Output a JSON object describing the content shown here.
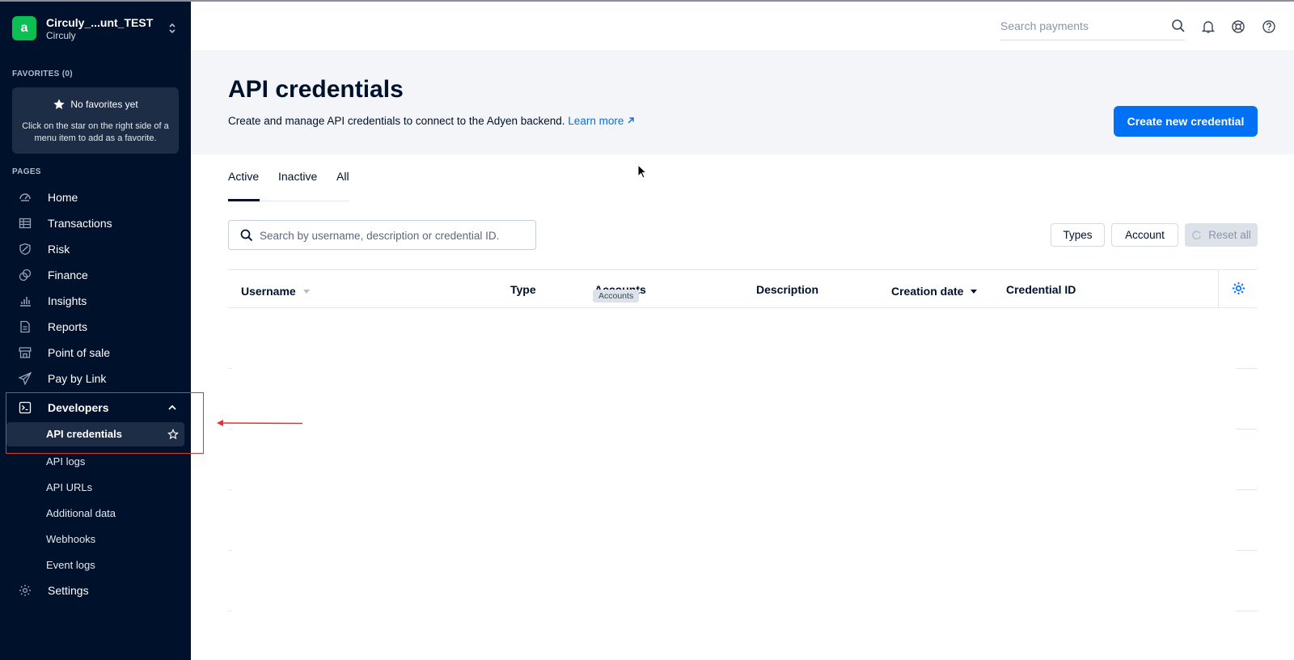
{
  "account": {
    "logo_letter": "a",
    "name": "Circuly_...unt_TEST",
    "company": "Circuly"
  },
  "sidebar": {
    "favorites_label": "FAVORITES (0)",
    "favorites_empty_title": "No favorites yet",
    "favorites_empty_hint": "Click on the star on the right side of a menu item to add as a favorite.",
    "pages_label": "PAGES",
    "items": [
      {
        "label": "Home",
        "icon": "home-icon"
      },
      {
        "label": "Transactions",
        "icon": "transactions-icon"
      },
      {
        "label": "Risk",
        "icon": "risk-icon"
      },
      {
        "label": "Finance",
        "icon": "finance-icon"
      },
      {
        "label": "Insights",
        "icon": "insights-icon"
      },
      {
        "label": "Reports",
        "icon": "reports-icon"
      },
      {
        "label": "Point of sale",
        "icon": "point-of-sale-icon"
      },
      {
        "label": "Pay by Link",
        "icon": "pay-by-link-icon"
      },
      {
        "label": "Developers",
        "icon": "developers-icon"
      },
      {
        "label": "Settings",
        "icon": "settings-icon"
      }
    ],
    "developers_sub": [
      {
        "label": "API credentials"
      },
      {
        "label": "API logs"
      },
      {
        "label": "API URLs"
      },
      {
        "label": "Additional data"
      },
      {
        "label": "Webhooks"
      },
      {
        "label": "Event logs"
      }
    ]
  },
  "topbar": {
    "search_placeholder": "Search payments"
  },
  "page": {
    "title": "API credentials",
    "description": "Create and manage API credentials to connect to the Adyen backend.",
    "learn_more": "Learn more",
    "create_button": "Create new credential"
  },
  "tabs": [
    {
      "label": "Active"
    },
    {
      "label": "Inactive"
    },
    {
      "label": "All"
    }
  ],
  "filters": {
    "search_placeholder": "Search by username, description or credential ID.",
    "types": "Types",
    "account": "Account",
    "reset_all": "Reset all"
  },
  "table": {
    "columns": [
      {
        "label": "Username"
      },
      {
        "label": "Type"
      },
      {
        "label": "Accounts"
      },
      {
        "label": "Description"
      },
      {
        "label": "Creation date"
      },
      {
        "label": "Credential ID"
      }
    ],
    "tooltip": "Accounts"
  },
  "colors": {
    "sidebar_bg": "#00112c",
    "accent": "#0070f5",
    "logo_green": "#0abf53",
    "annotation_red": "#e5332a"
  }
}
